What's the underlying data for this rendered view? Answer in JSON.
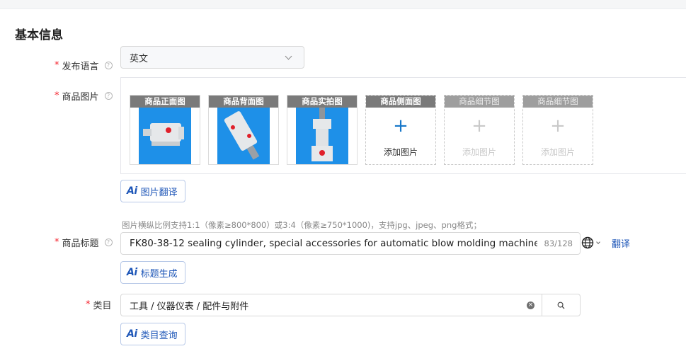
{
  "section": {
    "title": "基本信息"
  },
  "language": {
    "label": "发布语言",
    "value": "英文"
  },
  "images": {
    "label": "商品图片",
    "slots": [
      {
        "caption": "商品正面图",
        "filled": true
      },
      {
        "caption": "商品背面图",
        "filled": true
      },
      {
        "caption": "商品实拍图",
        "filled": true
      },
      {
        "caption": "商品侧面图",
        "filled": false,
        "add_label": "添加图片"
      },
      {
        "caption": "商品细节图",
        "filled": false,
        "add_label": "添加图片"
      },
      {
        "caption": "商品细节图",
        "filled": false,
        "add_label": "添加图片"
      }
    ],
    "ai_button": "图片翻译",
    "hint": "图片横纵比例支持1:1（像素≥800*800）或3:4（像素≥750*1000)，支持jpg、jpeg、png格式；"
  },
  "product_title": {
    "label": "商品标题",
    "value": "FK80-38-12 sealing cylinder, special accessories for automatic blow molding machine",
    "counter": "83/128",
    "translate": "翻译",
    "ai_button": "标题生成"
  },
  "category": {
    "label": "类目",
    "value": "工具 / 仪器仪表 / 配件与附件",
    "ai_button": "类目查询"
  },
  "common": {
    "ai_icon": "Ai",
    "required_mark": "*",
    "help_mark": "?",
    "plus": "+",
    "clear_mark": "×"
  },
  "colors": {
    "accent": "#1f57b8",
    "required": "#f5222d",
    "photo_bg": "#1e90e8"
  }
}
